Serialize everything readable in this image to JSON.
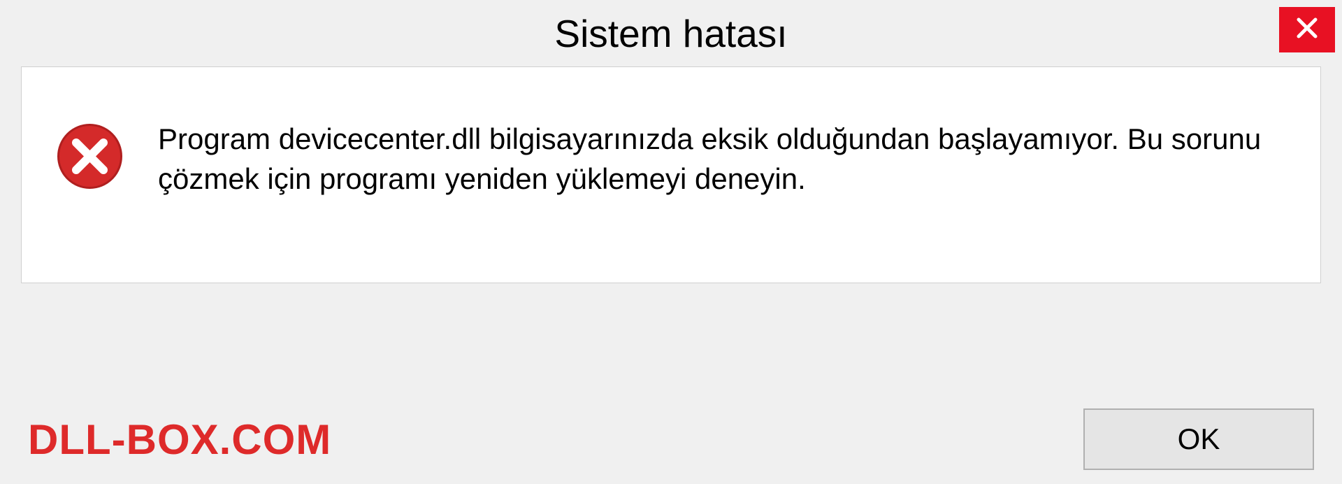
{
  "dialog": {
    "title": "Sistem hatası",
    "message": "Program devicecenter.dll bilgisayarınızda eksik olduğundan başlayamıyor. Bu sorunu çözmek için programı yeniden yüklemeyi deneyin.",
    "ok_label": "OK"
  },
  "watermark": "DLL-BOX.COM",
  "colors": {
    "close_button": "#e81123",
    "error_icon": "#d42a2a",
    "watermark": "#de2a2a"
  }
}
